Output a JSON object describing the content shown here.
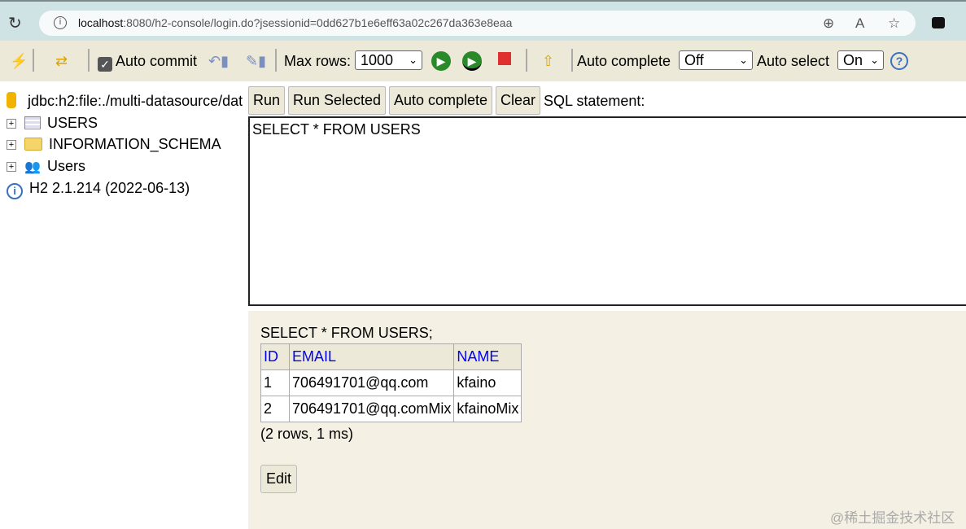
{
  "browser": {
    "url_host": "localhost",
    "url_rest": ":8080/h2-console/login.do?jsessionid=0dd627b1e6eff63a02c267da363e8eaa"
  },
  "toolbar": {
    "auto_commit": "Auto commit",
    "auto_commit_checked": true,
    "max_rows_label": "Max rows:",
    "max_rows": "1000",
    "auto_complete_label": "Auto complete",
    "auto_complete": "Off",
    "auto_select_label": "Auto select",
    "auto_select": "On"
  },
  "tree": {
    "connection": "jdbc:h2:file:./multi-datasource/dat",
    "items": [
      {
        "label": "USERS",
        "icon": "table-icon"
      },
      {
        "label": "INFORMATION_SCHEMA",
        "icon": "folder-icon"
      },
      {
        "label": "Users",
        "icon": "users-icon"
      }
    ],
    "version": "H2 2.1.214 (2022-06-13)"
  },
  "buttons": {
    "run": "Run",
    "run_selected": "Run Selected",
    "auto_complete": "Auto complete",
    "clear": "Clear",
    "sql_label": "SQL statement:"
  },
  "editor": {
    "sql": "SELECT * FROM USERS"
  },
  "results": {
    "query": "SELECT * FROM USERS;",
    "columns": [
      "ID",
      "EMAIL",
      "NAME"
    ],
    "rows": [
      [
        "1",
        "706491701@qq.com",
        "kfaino"
      ],
      [
        "2",
        "706491701@qq.comMix",
        "kfainoMix"
      ]
    ],
    "summary": "(2 rows, 1 ms)",
    "edit": "Edit"
  },
  "watermark": "@稀土掘金技术社区"
}
